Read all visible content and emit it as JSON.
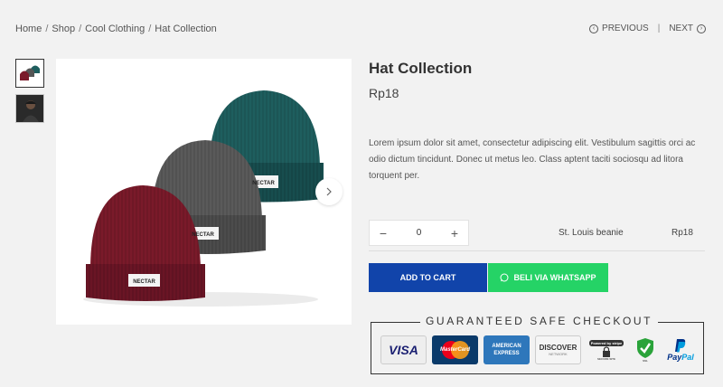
{
  "breadcrumb": {
    "home": "Home",
    "shop": "Shop",
    "category": "Cool Clothing",
    "current": "Hat Collection",
    "separator": "/"
  },
  "pager": {
    "previous": "PREVIOUS",
    "next": "NEXT",
    "divider": "|"
  },
  "product": {
    "title": "Hat Collection",
    "price": "Rp18",
    "description": "Lorem ipsum dolor sit amet, consectetur adipiscing elit. Vestibulum sagittis orci ac odio dictum tincidunt. Donec ut metus leo. Class aptent taciti sociosqu ad litora torquent per.",
    "hat_label": "NECTAR"
  },
  "quantity": {
    "value": "0",
    "minus": "−",
    "plus": "+"
  },
  "variant": {
    "name": "St. Louis beanie",
    "price": "Rp18"
  },
  "actions": {
    "add_to_cart": "ADD TO CART",
    "whatsapp": "BELI VIA WHATSAPP"
  },
  "checkout": {
    "title": "GUARANTEED SAFE CHECKOUT",
    "badges": {
      "visa": "VISA",
      "mastercard": "MasterCard",
      "amex": "AMERICAN EXPRESS",
      "discover": "DISCOVER",
      "discover_sub": "NETWORK",
      "stripe": "Powered by stripe",
      "stripe_sub": "SECURE SITE",
      "ssl": "SSL",
      "paypal_pay": "Pay",
      "paypal_pal": "Pal"
    }
  },
  "colors": {
    "add_to_cart": "#1144aa",
    "whatsapp": "#25d366",
    "background": "#f2f2f2",
    "hat_red": "#7a1a2a",
    "hat_grey": "#555555",
    "hat_teal": "#1e5e5e"
  }
}
